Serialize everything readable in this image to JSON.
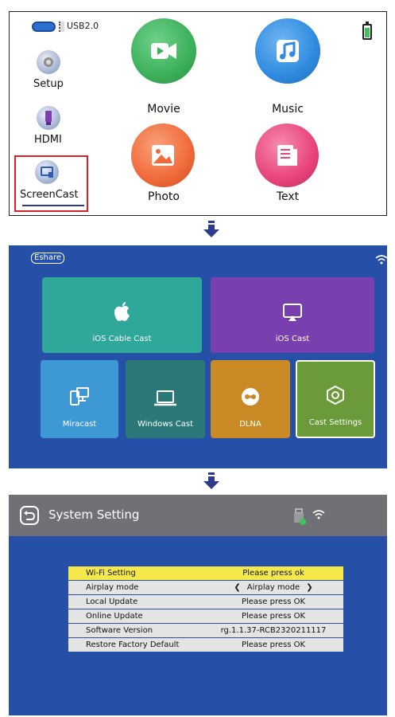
{
  "panel1": {
    "usb_label": "USB2.0",
    "sidebar": [
      {
        "label": "Setup",
        "icon": "gear-icon"
      },
      {
        "label": "HDMI",
        "icon": "hdmi-icon"
      },
      {
        "label": "ScreenCast",
        "icon": "screencast-icon"
      }
    ],
    "apps": [
      {
        "label": "Movie",
        "icon": "video-camera-icon",
        "color": "#3cb05a"
      },
      {
        "label": "Music",
        "icon": "music-note-icon",
        "color": "#2f8be0"
      },
      {
        "label": "Photo",
        "icon": "photo-icon",
        "color": "#f06a3a"
      },
      {
        "label": "Text",
        "icon": "document-icon",
        "color": "#e8437a"
      }
    ],
    "selection_color": "#d8202a"
  },
  "panel2": {
    "logo": "Eshare",
    "tiles": [
      {
        "label": "iOS Cable Cast",
        "icon": "apple-icon",
        "color": "#2fa89a"
      },
      {
        "label": "iOS Cast",
        "icon": "airplay-icon",
        "color": "#7a3fae"
      },
      {
        "label": "Miracast",
        "icon": "devices-icon",
        "color": "#3e98d4"
      },
      {
        "label": "Windows Cast",
        "icon": "laptop-icon",
        "color": "#2b7878"
      },
      {
        "label": "DLNA",
        "icon": "dlna-icon",
        "color": "#c98a26"
      },
      {
        "label": "Cast Settings",
        "icon": "settings-hex-icon",
        "color": "#6b9a3a"
      }
    ]
  },
  "panel3": {
    "title": "System Setting",
    "rows": [
      {
        "label": "Wi-Fi Setting",
        "value": "Please press ok"
      },
      {
        "label": "Airplay mode",
        "value": "Airplay mode"
      },
      {
        "label": "Local Update",
        "value": "Please press OK"
      },
      {
        "label": "Online Update",
        "value": "Please press OK"
      },
      {
        "label": "Software Version",
        "value": "rg.1.1.37-RCB2320211117"
      },
      {
        "label": "Restore Factory Default",
        "value": "Please press OK"
      }
    ]
  }
}
